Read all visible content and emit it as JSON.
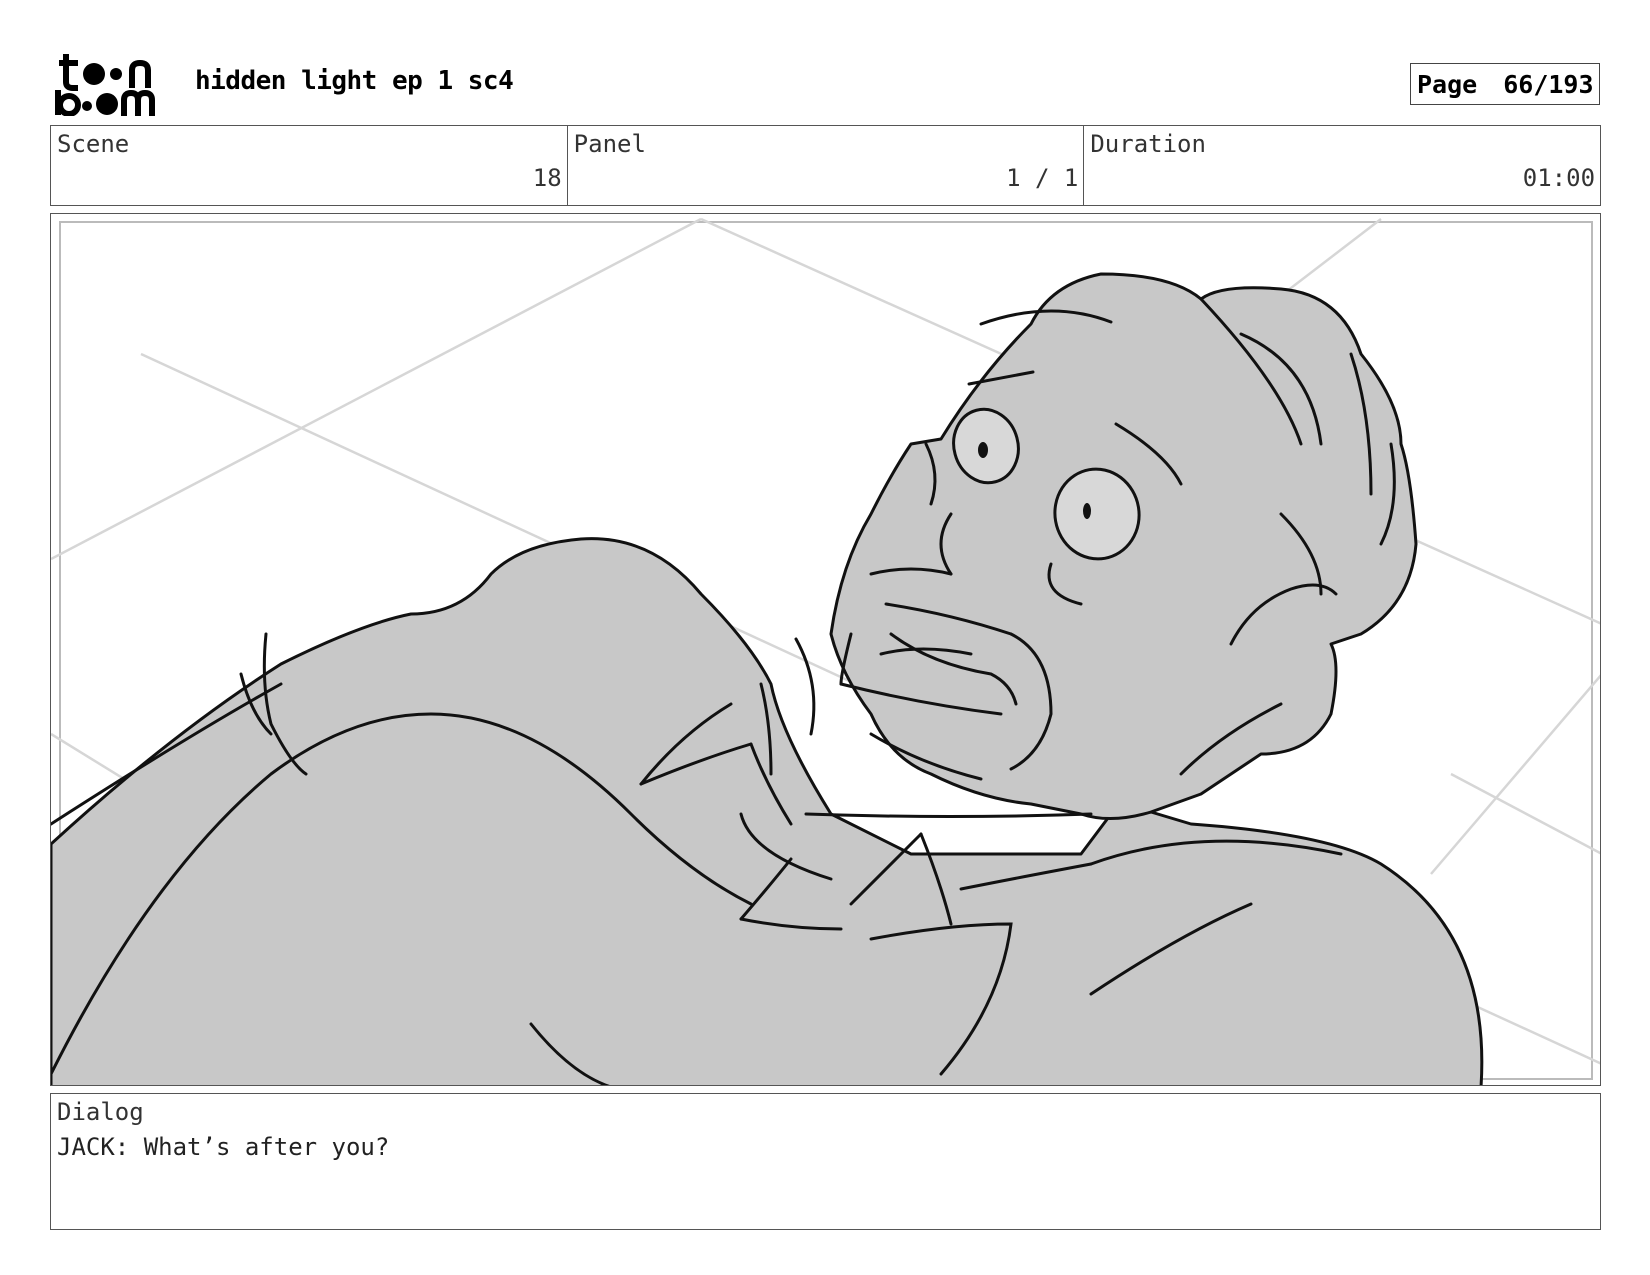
{
  "header": {
    "logo_text": "toonboom",
    "title": "hidden light ep 1 sc4",
    "page_label": "Page",
    "page_value": "66/193"
  },
  "info": {
    "scene_label": "Scene",
    "scene_value": "18",
    "panel_label": "Panel",
    "panel_value": "1 / 1",
    "duration_label": "Duration",
    "duration_value": "01:00"
  },
  "panel_image": {
    "description_icon": "storyboard-sketch-frightened-man"
  },
  "dialog": {
    "label": "Dialog",
    "text": "JACK: What’s after you?"
  },
  "colors": {
    "fill": "#c8c8c8",
    "line": "#111111",
    "guide": "#d6d6d6"
  }
}
